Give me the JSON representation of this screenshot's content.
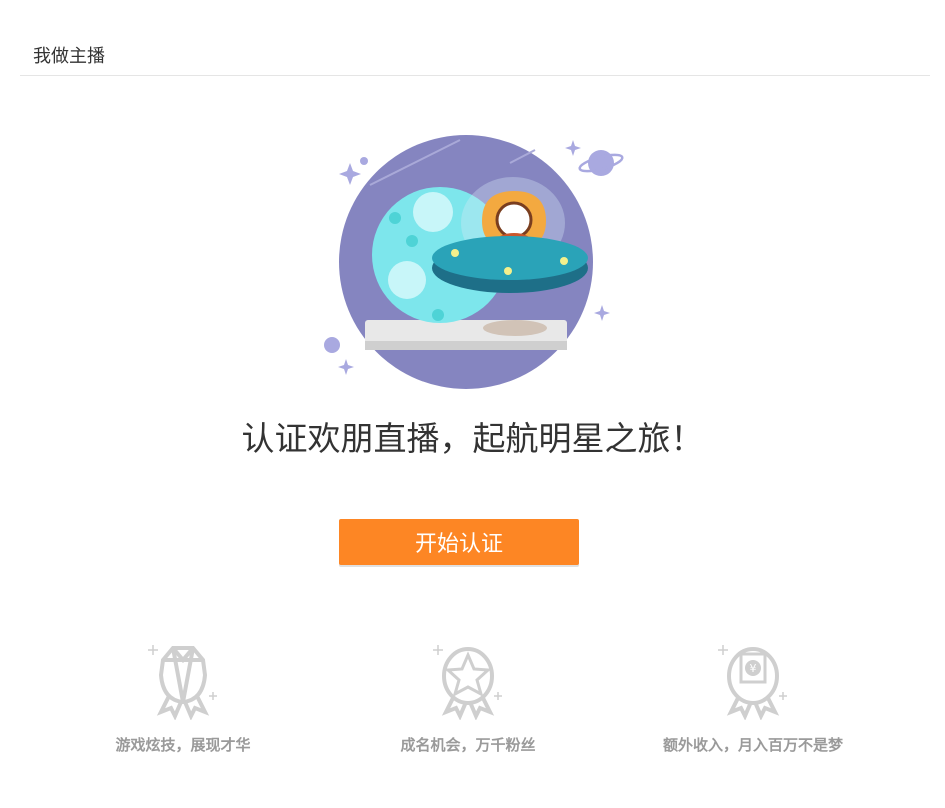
{
  "header": {
    "title": "我做主播"
  },
  "hero": {
    "illustration": "ufo-astronaut-illustration",
    "headline": "认证欢朋直播，起航明星之旅！"
  },
  "cta": {
    "label": "开始认证",
    "color": "#fd8624"
  },
  "features": [
    {
      "icon": "diamond-badge-icon",
      "label": "游戏炫技，展现才华"
    },
    {
      "icon": "star-badge-icon",
      "label": "成名机会，万千粉丝"
    },
    {
      "icon": "yuan-badge-icon",
      "label": "额外收入，月入百万不是梦"
    }
  ]
}
